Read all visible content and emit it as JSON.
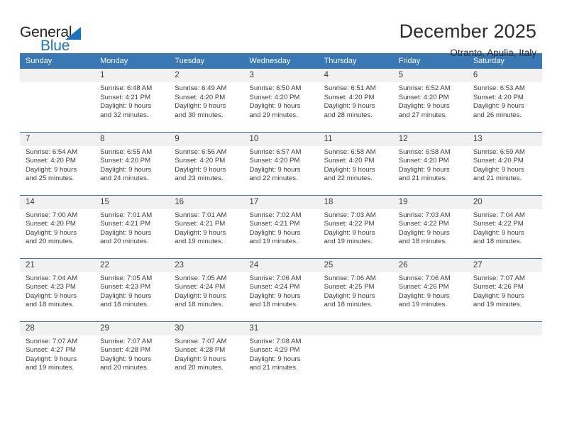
{
  "brand": {
    "name_top": "General",
    "name_bottom": "Blue",
    "accent_color": "#1b75bc",
    "triangle_icon": "triangle-icon"
  },
  "header": {
    "title": "December 2025",
    "subtitle": "Otranto, Apulia, Italy"
  },
  "calendar": {
    "header_bg": "#3a77b5",
    "daynum_bg": "#f1f1f1",
    "weekdays": [
      "Sunday",
      "Monday",
      "Tuesday",
      "Wednesday",
      "Thursday",
      "Friday",
      "Saturday"
    ],
    "weeks": [
      [
        {
          "day": "",
          "lines": []
        },
        {
          "day": "1",
          "lines": [
            "Sunrise: 6:48 AM",
            "Sunset: 4:21 PM",
            "Daylight: 9 hours",
            "and 32 minutes."
          ]
        },
        {
          "day": "2",
          "lines": [
            "Sunrise: 6:49 AM",
            "Sunset: 4:20 PM",
            "Daylight: 9 hours",
            "and 30 minutes."
          ]
        },
        {
          "day": "3",
          "lines": [
            "Sunrise: 6:50 AM",
            "Sunset: 4:20 PM",
            "Daylight: 9 hours",
            "and 29 minutes."
          ]
        },
        {
          "day": "4",
          "lines": [
            "Sunrise: 6:51 AM",
            "Sunset: 4:20 PM",
            "Daylight: 9 hours",
            "and 28 minutes."
          ]
        },
        {
          "day": "5",
          "lines": [
            "Sunrise: 6:52 AM",
            "Sunset: 4:20 PM",
            "Daylight: 9 hours",
            "and 27 minutes."
          ]
        },
        {
          "day": "6",
          "lines": [
            "Sunrise: 6:53 AM",
            "Sunset: 4:20 PM",
            "Daylight: 9 hours",
            "and 26 minutes."
          ]
        }
      ],
      [
        {
          "day": "7",
          "lines": [
            "Sunrise: 6:54 AM",
            "Sunset: 4:20 PM",
            "Daylight: 9 hours",
            "and 25 minutes."
          ]
        },
        {
          "day": "8",
          "lines": [
            "Sunrise: 6:55 AM",
            "Sunset: 4:20 PM",
            "Daylight: 9 hours",
            "and 24 minutes."
          ]
        },
        {
          "day": "9",
          "lines": [
            "Sunrise: 6:56 AM",
            "Sunset: 4:20 PM",
            "Daylight: 9 hours",
            "and 23 minutes."
          ]
        },
        {
          "day": "10",
          "lines": [
            "Sunrise: 6:57 AM",
            "Sunset: 4:20 PM",
            "Daylight: 9 hours",
            "and 22 minutes."
          ]
        },
        {
          "day": "11",
          "lines": [
            "Sunrise: 6:58 AM",
            "Sunset: 4:20 PM",
            "Daylight: 9 hours",
            "and 22 minutes."
          ]
        },
        {
          "day": "12",
          "lines": [
            "Sunrise: 6:58 AM",
            "Sunset: 4:20 PM",
            "Daylight: 9 hours",
            "and 21 minutes."
          ]
        },
        {
          "day": "13",
          "lines": [
            "Sunrise: 6:59 AM",
            "Sunset: 4:20 PM",
            "Daylight: 9 hours",
            "and 21 minutes."
          ]
        }
      ],
      [
        {
          "day": "14",
          "lines": [
            "Sunrise: 7:00 AM",
            "Sunset: 4:20 PM",
            "Daylight: 9 hours",
            "and 20 minutes."
          ]
        },
        {
          "day": "15",
          "lines": [
            "Sunrise: 7:01 AM",
            "Sunset: 4:21 PM",
            "Daylight: 9 hours",
            "and 20 minutes."
          ]
        },
        {
          "day": "16",
          "lines": [
            "Sunrise: 7:01 AM",
            "Sunset: 4:21 PM",
            "Daylight: 9 hours",
            "and 19 minutes."
          ]
        },
        {
          "day": "17",
          "lines": [
            "Sunrise: 7:02 AM",
            "Sunset: 4:21 PM",
            "Daylight: 9 hours",
            "and 19 minutes."
          ]
        },
        {
          "day": "18",
          "lines": [
            "Sunrise: 7:03 AM",
            "Sunset: 4:22 PM",
            "Daylight: 9 hours",
            "and 19 minutes."
          ]
        },
        {
          "day": "19",
          "lines": [
            "Sunrise: 7:03 AM",
            "Sunset: 4:22 PM",
            "Daylight: 9 hours",
            "and 18 minutes."
          ]
        },
        {
          "day": "20",
          "lines": [
            "Sunrise: 7:04 AM",
            "Sunset: 4:22 PM",
            "Daylight: 9 hours",
            "and 18 minutes."
          ]
        }
      ],
      [
        {
          "day": "21",
          "lines": [
            "Sunrise: 7:04 AM",
            "Sunset: 4:23 PM",
            "Daylight: 9 hours",
            "and 18 minutes."
          ]
        },
        {
          "day": "22",
          "lines": [
            "Sunrise: 7:05 AM",
            "Sunset: 4:23 PM",
            "Daylight: 9 hours",
            "and 18 minutes."
          ]
        },
        {
          "day": "23",
          "lines": [
            "Sunrise: 7:05 AM",
            "Sunset: 4:24 PM",
            "Daylight: 9 hours",
            "and 18 minutes."
          ]
        },
        {
          "day": "24",
          "lines": [
            "Sunrise: 7:06 AM",
            "Sunset: 4:24 PM",
            "Daylight: 9 hours",
            "and 18 minutes."
          ]
        },
        {
          "day": "25",
          "lines": [
            "Sunrise: 7:06 AM",
            "Sunset: 4:25 PM",
            "Daylight: 9 hours",
            "and 18 minutes."
          ]
        },
        {
          "day": "26",
          "lines": [
            "Sunrise: 7:06 AM",
            "Sunset: 4:26 PM",
            "Daylight: 9 hours",
            "and 19 minutes."
          ]
        },
        {
          "day": "27",
          "lines": [
            "Sunrise: 7:07 AM",
            "Sunset: 4:26 PM",
            "Daylight: 9 hours",
            "and 19 minutes."
          ]
        }
      ],
      [
        {
          "day": "28",
          "lines": [
            "Sunrise: 7:07 AM",
            "Sunset: 4:27 PM",
            "Daylight: 9 hours",
            "and 19 minutes."
          ]
        },
        {
          "day": "29",
          "lines": [
            "Sunrise: 7:07 AM",
            "Sunset: 4:28 PM",
            "Daylight: 9 hours",
            "and 20 minutes."
          ]
        },
        {
          "day": "30",
          "lines": [
            "Sunrise: 7:07 AM",
            "Sunset: 4:28 PM",
            "Daylight: 9 hours",
            "and 20 minutes."
          ]
        },
        {
          "day": "31",
          "lines": [
            "Sunrise: 7:08 AM",
            "Sunset: 4:29 PM",
            "Daylight: 9 hours",
            "and 21 minutes."
          ]
        },
        {
          "day": "",
          "lines": []
        },
        {
          "day": "",
          "lines": []
        },
        {
          "day": "",
          "lines": []
        }
      ]
    ]
  }
}
